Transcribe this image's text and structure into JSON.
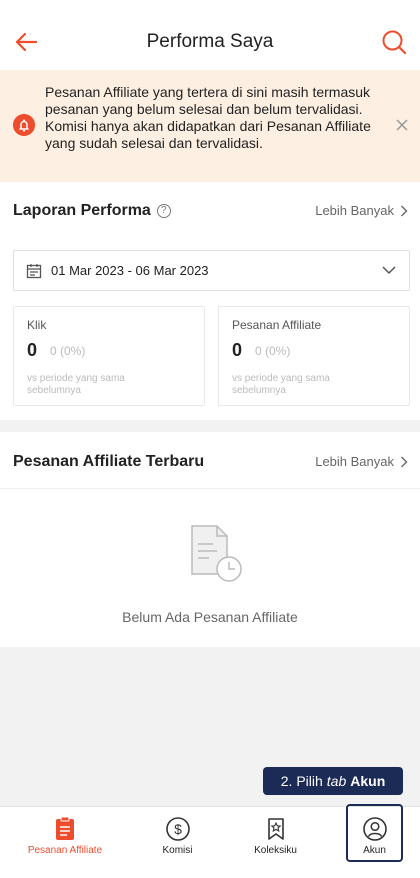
{
  "header": {
    "title": "Performa Saya",
    "back_icon": "arrow-left-icon",
    "search_icon": "search-icon",
    "accent": "#ee4d2d"
  },
  "notice": {
    "text": "Pesanan Affiliate yang tertera di sini masih termasuk pesanan yang belum selesai dan belum tervalidasi. Komisi hanya akan didapatkan dari Pesanan Affiliate yang sudah selesai dan tervalidasi.",
    "background": "#fdf0e3"
  },
  "report": {
    "title": "Laporan Performa",
    "more": "Lebih Banyak",
    "date_range": "01 Mar 2023 - 06 Mar 2023",
    "stats": [
      {
        "label": "Klik",
        "value": "0",
        "change": "0 (0%)",
        "compare": "vs periode yang sama sebelumnya"
      },
      {
        "label": "Pesanan Affiliate",
        "value": "0",
        "change": "0 (0%)",
        "compare": "vs periode yang sama sebelumnya"
      }
    ]
  },
  "latest": {
    "title": "Pesanan Affiliate Terbaru",
    "more": "Lebih Banyak",
    "empty_text": "Belum Ada Pesanan Affiliate"
  },
  "tooltip": {
    "prefix": "2. Pilih",
    "italic": "tab",
    "bold": "Akun",
    "background": "#1c2b56"
  },
  "bottom_nav": {
    "tabs": [
      {
        "label": "Pesanan Affiliate",
        "icon": "clipboard-icon",
        "active": true
      },
      {
        "label": "Komisi",
        "icon": "dollar-icon",
        "active": false
      },
      {
        "label": "Koleksiku",
        "icon": "bookmark-star-icon",
        "active": false
      },
      {
        "label": "Akun",
        "icon": "user-icon",
        "active": false
      }
    ]
  }
}
